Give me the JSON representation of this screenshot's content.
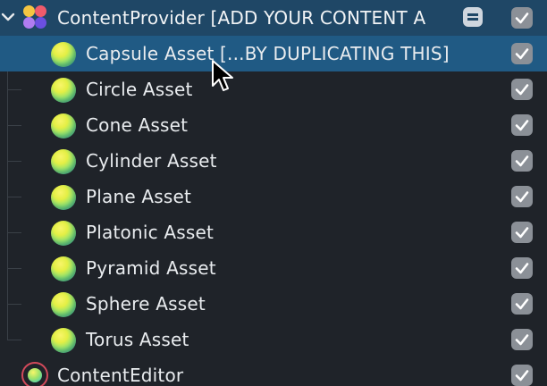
{
  "parent": {
    "label": "ContentProvider [ADD YOUR CONTENT A",
    "checked": true
  },
  "children": [
    {
      "label": "Capsule Asset [...BY DUPLICATING THIS]",
      "checked": true,
      "selected": true
    },
    {
      "label": "Circle Asset",
      "checked": true,
      "selected": false
    },
    {
      "label": "Cone Asset",
      "checked": true,
      "selected": false
    },
    {
      "label": "Cylinder Asset",
      "checked": true,
      "selected": false
    },
    {
      "label": "Plane Asset",
      "checked": true,
      "selected": false
    },
    {
      "label": "Platonic Asset",
      "checked": true,
      "selected": false
    },
    {
      "label": "Pyramid Asset",
      "checked": true,
      "selected": false
    },
    {
      "label": "Sphere Asset",
      "checked": true,
      "selected": false
    },
    {
      "label": "Torus Asset",
      "checked": true,
      "selected": false
    }
  ],
  "sibling": {
    "label": "ContentEditor",
    "checked": true
  },
  "colors": {
    "background": "#1f2329",
    "parent_row": "#1f4766",
    "selected_row": "#205a84",
    "checkbox": "#8b9097",
    "text": "#e9ecef"
  },
  "icons": {
    "expand": "chevron-down-icon",
    "parent": "content-provider-icon",
    "parent_badge": "prefab-badge-icon",
    "asset": "sphere-asset-icon",
    "sibling": "content-editor-icon",
    "checkbox": "checkbox-checked-icon",
    "pointer": "mouse-pointer-icon"
  }
}
